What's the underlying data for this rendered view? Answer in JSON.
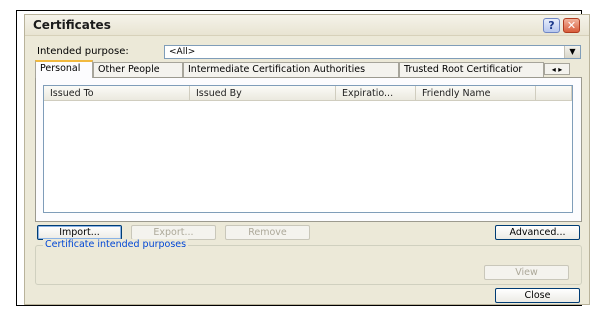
{
  "window": {
    "title": "Certificates"
  },
  "title_buttons": {
    "help": "?",
    "close": "✕"
  },
  "intended_purpose": {
    "label": "Intended purpose:",
    "value": "<All>"
  },
  "tabs": [
    {
      "label": "Personal"
    },
    {
      "label": "Other People"
    },
    {
      "label": "Intermediate Certification Authorities"
    },
    {
      "label": "Trusted Root Certificatior"
    }
  ],
  "tab_scroll": {
    "left": "◂",
    "right": "▸"
  },
  "columns": [
    {
      "label": "Issued To"
    },
    {
      "label": "Issued By"
    },
    {
      "label": "Expiratio..."
    },
    {
      "label": "Friendly Name"
    }
  ],
  "buttons": {
    "import": "Import...",
    "export": "Export...",
    "remove": "Remove",
    "advanced": "Advanced...",
    "view": "View",
    "close": "Close"
  },
  "group": {
    "title": "Certificate intended purposes"
  }
}
